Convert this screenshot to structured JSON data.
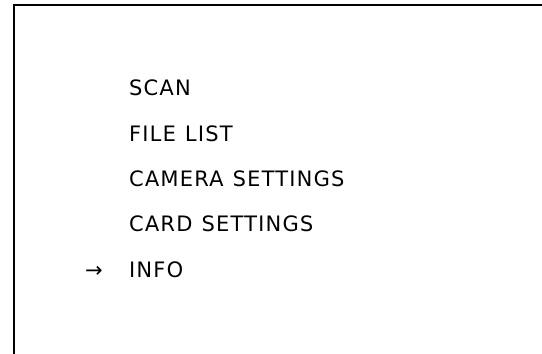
{
  "menu": {
    "items": [
      {
        "label": "SCAN"
      },
      {
        "label": "FILE LIST"
      },
      {
        "label": "CAMERA SETTINGS"
      },
      {
        "label": "CARD SETTINGS"
      },
      {
        "label": "INFO"
      }
    ],
    "selected_index": 4,
    "cursor_symbol": "→"
  },
  "colors": {
    "background": "#ffffff",
    "text": "#000000",
    "border": "#000000"
  }
}
